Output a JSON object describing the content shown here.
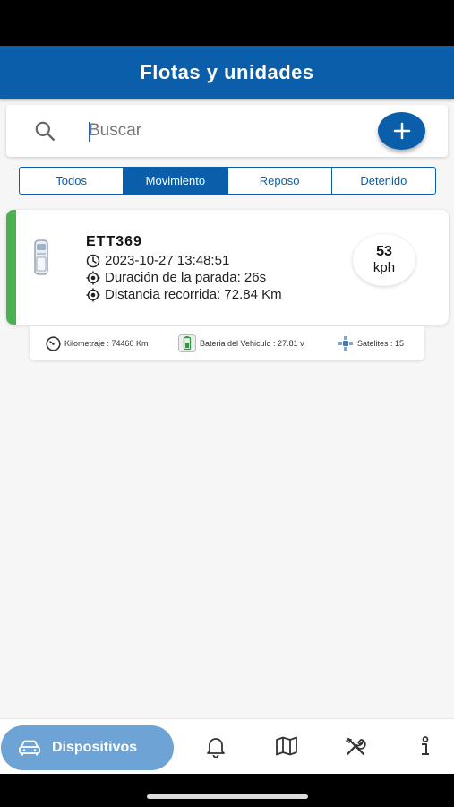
{
  "header": {
    "title": "Flotas y unidades"
  },
  "search": {
    "placeholder": "Buscar"
  },
  "tabs": [
    {
      "label": "Todos",
      "active": false
    },
    {
      "label": "Movimiento",
      "active": true
    },
    {
      "label": "Reposo",
      "active": false
    },
    {
      "label": "Detenido",
      "active": false
    }
  ],
  "vehicle": {
    "name": "ETT369",
    "timestamp": "2023-10-27 13:48:51",
    "stop_duration": "Duración de la parada: 26s",
    "distance": "Distancia recorrida: 72.84 Km",
    "speed_value": "53",
    "speed_unit": "kph",
    "status_color": "#4caf50"
  },
  "stats": {
    "odometer": "Kilometraje : 74460 Km",
    "battery": "Bateria del Vehiculo : 27.81 v",
    "satellites": "Satelites : 15"
  },
  "bottom_nav": {
    "active_label": "Dispositivos",
    "icons": [
      "car-icon",
      "bell-icon",
      "map-icon",
      "tools-icon",
      "info-icon"
    ]
  },
  "colors": {
    "primary": "#0b5ea9",
    "nav_active": "#6ea3d6"
  }
}
